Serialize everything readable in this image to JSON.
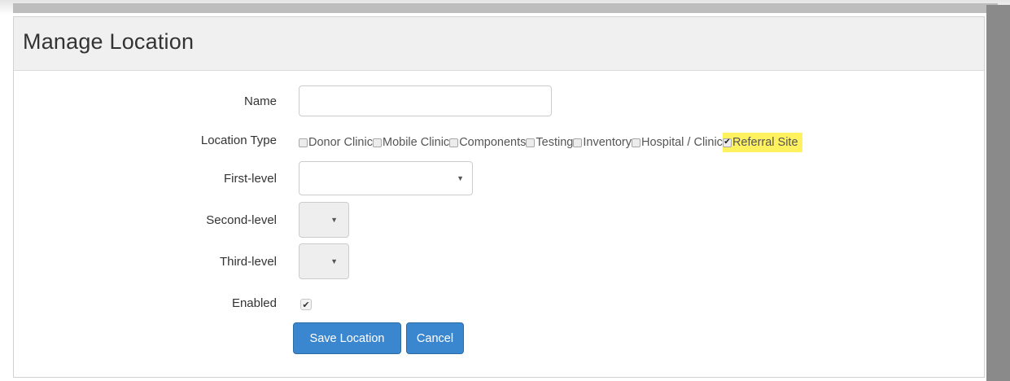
{
  "page": {
    "title": "Manage Location"
  },
  "form": {
    "name": {
      "label": "Name",
      "value": "",
      "placeholder": ""
    },
    "location_type": {
      "label": "Location Type",
      "options": [
        {
          "label": "Donor Clinic",
          "checked": false
        },
        {
          "label": "Mobile Clinic",
          "checked": false
        },
        {
          "label": "Components",
          "checked": false
        },
        {
          "label": "Testing",
          "checked": false
        },
        {
          "label": "Inventory",
          "checked": false
        },
        {
          "label": "Hospital / Clinic",
          "checked": false
        },
        {
          "label": "Referral Site",
          "checked": true,
          "highlighted": true
        }
      ]
    },
    "first_level": {
      "label": "First-level",
      "value": ""
    },
    "second_level": {
      "label": "Second-level",
      "value": ""
    },
    "third_level": {
      "label": "Third-level",
      "value": ""
    },
    "enabled": {
      "label": "Enabled",
      "checked": true
    }
  },
  "actions": {
    "save_label": "Save Location",
    "cancel_label": "Cancel"
  },
  "colors": {
    "primary_button": "#3a87cf",
    "highlight": "#fff25e"
  },
  "icons": {
    "check": "check-icon",
    "caret": "caret-down-icon"
  }
}
